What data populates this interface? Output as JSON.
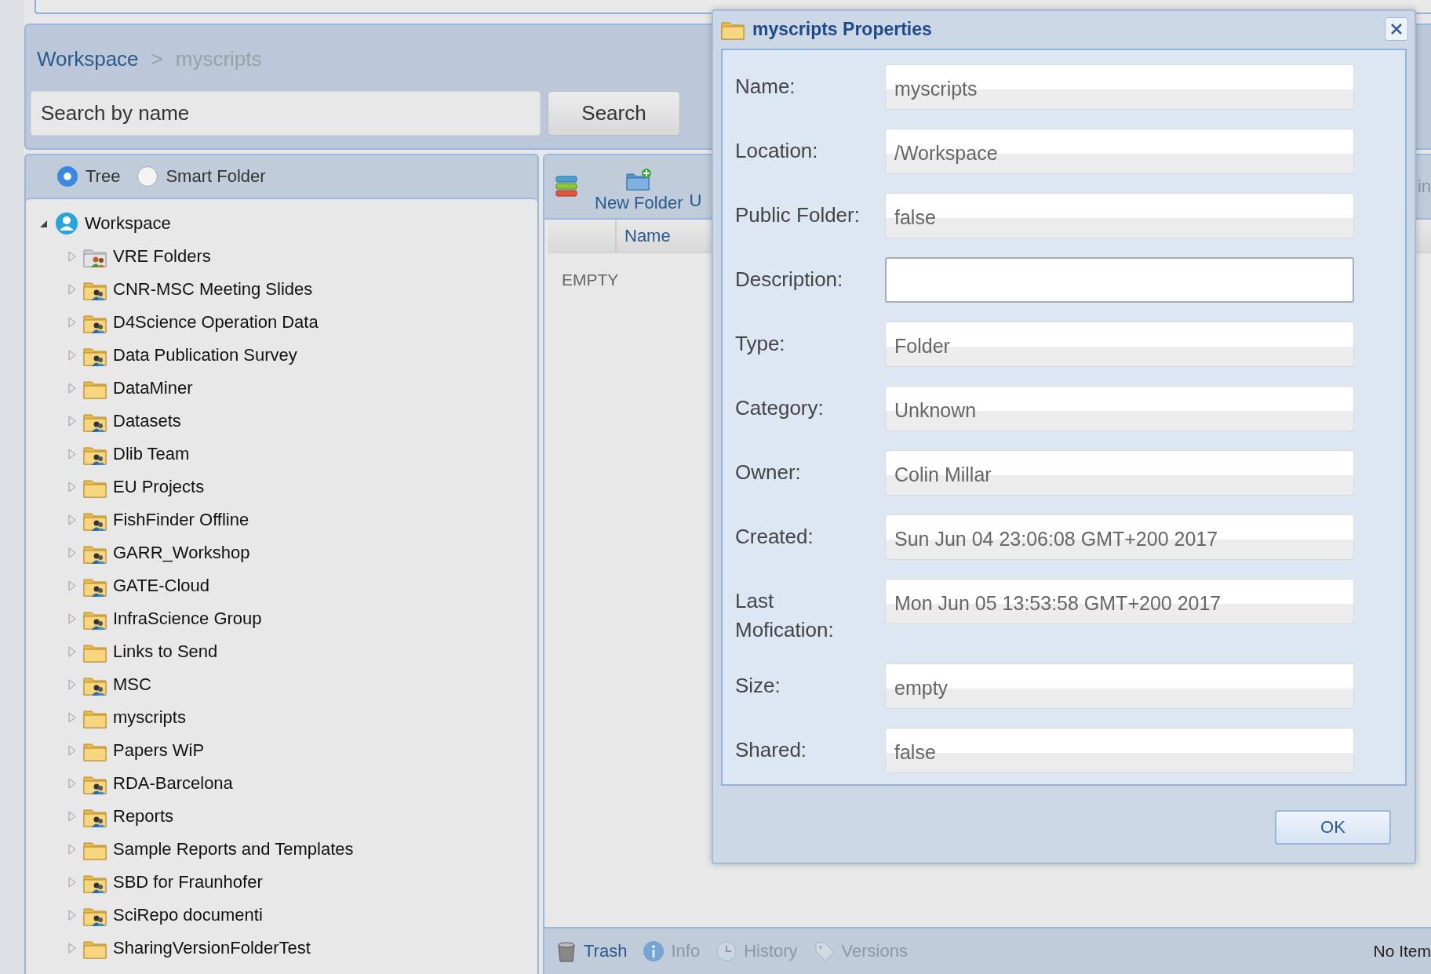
{
  "breadcrumb": [
    {
      "label": "Workspace",
      "kind": "link"
    },
    {
      "label": ">",
      "kind": "separator"
    },
    {
      "label": "myscripts",
      "kind": "current"
    }
  ],
  "search": {
    "placeholder": "Search by name",
    "button": "Search"
  },
  "view_modes": [
    {
      "label": "Tree",
      "selected": true
    },
    {
      "label": "Smart Folder",
      "selected": false
    }
  ],
  "tree": {
    "label": "Workspace",
    "expanded": true,
    "children": [
      {
        "label": "VRE Folders",
        "kind": "vre",
        "expanded": false
      },
      {
        "label": "CNR-MSC Meeting Slides",
        "kind": "shared",
        "expanded": false
      },
      {
        "label": "D4Science Operation Data",
        "kind": "shared",
        "expanded": false
      },
      {
        "label": "Data Publication Survey",
        "kind": "shared",
        "expanded": false
      },
      {
        "label": "DataMiner",
        "kind": "folder",
        "expanded": false
      },
      {
        "label": "Datasets",
        "kind": "shared",
        "expanded": false
      },
      {
        "label": "Dlib Team",
        "kind": "shared",
        "expanded": false
      },
      {
        "label": "EU Projects",
        "kind": "folder",
        "expanded": false
      },
      {
        "label": "FishFinder Offline",
        "kind": "shared",
        "expanded": false
      },
      {
        "label": "GARR_Workshop",
        "kind": "shared",
        "expanded": false
      },
      {
        "label": "GATE-Cloud",
        "kind": "shared",
        "expanded": false
      },
      {
        "label": "InfraScience Group",
        "kind": "shared",
        "expanded": false
      },
      {
        "label": "Links to Send",
        "kind": "folder",
        "expanded": false
      },
      {
        "label": "MSC",
        "kind": "shared",
        "expanded": false
      },
      {
        "label": "myscripts",
        "kind": "folder",
        "expanded": false
      },
      {
        "label": "Papers WiP",
        "kind": "folder",
        "expanded": false
      },
      {
        "label": "RDA-Barcelona",
        "kind": "shared",
        "expanded": false
      },
      {
        "label": "Reports",
        "kind": "shared",
        "expanded": false
      },
      {
        "label": "Sample Reports and Templates",
        "kind": "folder",
        "expanded": false
      },
      {
        "label": "SBD for Fraunhofer",
        "kind": "shared",
        "expanded": false
      },
      {
        "label": "SciRepo documenti",
        "kind": "shared",
        "expanded": false
      },
      {
        "label": "SharingVersionFolderTest",
        "kind": "folder",
        "expanded": false
      }
    ]
  },
  "toolbar": [
    {
      "kind": "list"
    },
    {
      "label": "New Folder",
      "kind": "new-folder"
    },
    {
      "label": "U",
      "kind": "text"
    },
    {
      "label": "in",
      "kind": "end"
    }
  ],
  "table": {
    "columns": [
      "Name"
    ],
    "empty_text": "EMPTY"
  },
  "bottom_bar": {
    "actions": [
      {
        "label": "Trash",
        "kind": "trash",
        "disabled": false
      },
      {
        "label": "Info",
        "kind": "info",
        "disabled": true
      },
      {
        "label": "History",
        "kind": "history",
        "disabled": true
      },
      {
        "label": "Versions",
        "kind": "versions",
        "disabled": true
      }
    ],
    "status": "No Item"
  },
  "dialog": {
    "title": "myscripts Properties",
    "fields": [
      {
        "label": "Name:",
        "value": "myscripts",
        "editable": false
      },
      {
        "label": "Location:",
        "value": "/Workspace",
        "editable": false
      },
      {
        "label": "Public Folder:",
        "value": "false",
        "editable": false
      },
      {
        "label": "Description:",
        "editable": true
      },
      {
        "label": "Type:",
        "value": "Folder",
        "editable": false
      },
      {
        "label": "Category:",
        "value": "Unknown",
        "editable": false
      },
      {
        "label": "Owner:",
        "value": "Colin Millar",
        "editable": false
      },
      {
        "label": "Created:",
        "value": "Sun Jun 04 23:06:08 GMT+200 2017",
        "editable": false
      },
      {
        "label": "Last Mofication:",
        "value": "Mon Jun 05 13:53:58 GMT+200 2017",
        "editable": false
      },
      {
        "label": "Size:",
        "value": "empty",
        "editable": false
      },
      {
        "label": "Shared:",
        "value": "false",
        "editable": false
      }
    ],
    "ok": "OK"
  }
}
